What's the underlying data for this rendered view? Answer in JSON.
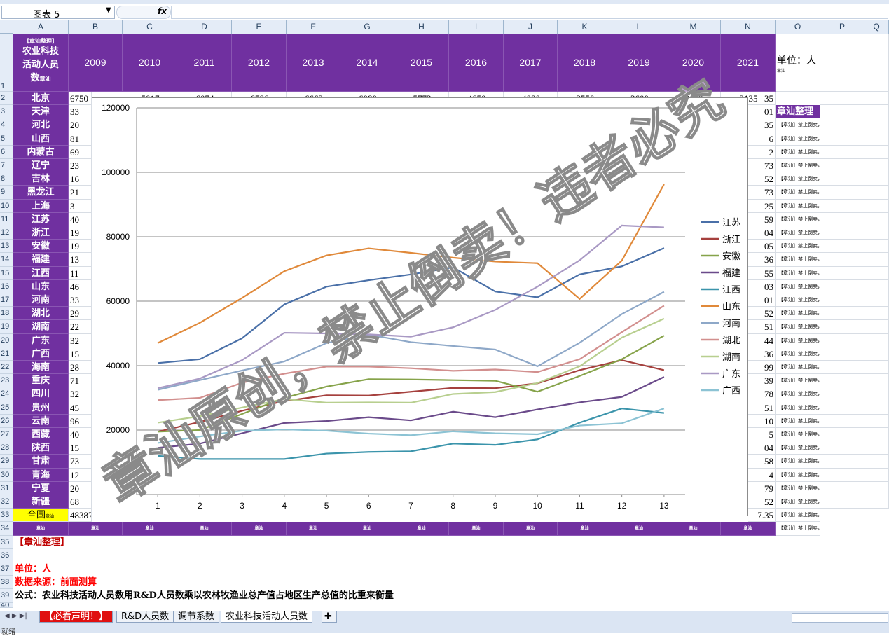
{
  "formula_bar": {
    "name_box": "图表 5",
    "fx": "fx"
  },
  "columns": [
    "A",
    "B",
    "C",
    "D",
    "E",
    "F",
    "G",
    "H",
    "I",
    "J",
    "K",
    "L",
    "M",
    "N",
    "O",
    "P",
    "Q"
  ],
  "rows": [
    "1",
    "2",
    "3",
    "4",
    "5",
    "6",
    "7",
    "8",
    "9",
    "10",
    "11",
    "12",
    "13",
    "14",
    "15",
    "16",
    "17",
    "18",
    "19",
    "20",
    "21",
    "22",
    "23",
    "24",
    "25",
    "26",
    "27",
    "28",
    "29",
    "30",
    "31",
    "32",
    "33",
    "34",
    "35",
    "36",
    "37",
    "38",
    "39",
    "40"
  ],
  "header": {
    "a1_tag": "【章汕整理】",
    "a1_title_line1": "农业科技",
    "a1_title_line2": "活动人员",
    "a1_title_line3": "数",
    "a1_title_mark": "章汕",
    "years": [
      "2009",
      "2010",
      "2011",
      "2012",
      "2013",
      "2014",
      "2015",
      "2016",
      "2017",
      "2018",
      "2019",
      "2020",
      "2021"
    ],
    "unit": "单位：人",
    "unit_mark": "章汕"
  },
  "provinces": [
    "北京",
    "天津",
    "河北",
    "山西",
    "内蒙古",
    "辽宁",
    "吉林",
    "黑龙江",
    "上海",
    "江苏",
    "浙江",
    "安徽",
    "福建",
    "江西",
    "山东",
    "河南",
    "湖北",
    "湖南",
    "广东",
    "广西",
    "海南",
    "重庆",
    "四川",
    "贵州",
    "云南",
    "西藏",
    "陕西",
    "甘肃",
    "青海",
    "宁夏",
    "新疆"
  ],
  "col_b_visible": [
    "6",
    "33",
    "20",
    "81",
    "69",
    "23",
    "16",
    "21",
    "3",
    "40",
    "19",
    "19",
    "13",
    "11",
    "46",
    "33",
    "29",
    "22",
    "32",
    "15",
    "28",
    "71",
    "32",
    "45",
    "96",
    "40",
    "15",
    "73",
    "12",
    "20",
    "68"
  ],
  "col_n_visible": [
    "35",
    "01",
    "35",
    "6",
    "2",
    "73",
    "52",
    "73",
    "25",
    "59",
    "04",
    "05",
    "36",
    "55",
    "03",
    "01",
    "52",
    "51",
    "44",
    "36",
    "99",
    "39",
    "78",
    "51",
    "10",
    "5",
    "04",
    "58",
    "4",
    "79",
    "52"
  ],
  "row2_partial": [
    "6750",
    "5017",
    "6074",
    "6786",
    "6663",
    "6080",
    "5773",
    "4650",
    "4080",
    "3550",
    "3600",
    "3160",
    "3135"
  ],
  "national": {
    "label": "全国",
    "mark": "章汕",
    "b_value": "48387",
    "n_value": "7.35"
  },
  "o_col": {
    "title": "章汕整理",
    "notice": "【章汕】禁止倒卖，违者必究"
  },
  "row34_mark": "章汕",
  "bottom_notes": {
    "a35": "【章汕整理】",
    "a37": "单位：人",
    "a38": "数据来源：前面测算",
    "a39": "公式：农业科技活动人员数用R&D人员数乘以农林牧渔业总产值占地区生产总值的比重来衡量"
  },
  "watermark": "章汕原创，禁止倒卖！违者必究",
  "sheet_tabs": [
    "【必看声明！】",
    "R&D人员数",
    "调节系数",
    "农业科技活动人员数"
  ],
  "status_text": "就绪",
  "chart_data": {
    "type": "line",
    "title": "",
    "xlabel": "",
    "ylabel": "",
    "x": [
      1,
      2,
      3,
      4,
      5,
      6,
      7,
      8,
      9,
      10,
      11,
      12,
      13
    ],
    "ylim": [
      0,
      120000
    ],
    "yticks": [
      0,
      20000,
      40000,
      60000,
      80000,
      100000,
      120000
    ],
    "grid": true,
    "legend_position": "right",
    "series": [
      {
        "name": "江苏",
        "color": "#4a70a8",
        "values": [
          40800,
          42000,
          48500,
          59000,
          64500,
          66500,
          68300,
          70500,
          63000,
          61200,
          68300,
          70800,
          76500
        ]
      },
      {
        "name": "浙江",
        "color": "#a5403d",
        "values": [
          19500,
          22500,
          26000,
          29000,
          30800,
          30700,
          31900,
          33100,
          33000,
          34500,
          38600,
          41700,
          38600
        ]
      },
      {
        "name": "安徽",
        "color": "#86a34a",
        "values": [
          19500,
          20000,
          25000,
          30000,
          33500,
          35800,
          35700,
          35500,
          35300,
          31900,
          36800,
          42000,
          49300
        ]
      },
      {
        "name": "福建",
        "color": "#6a4a8a",
        "values": [
          14500,
          15800,
          19000,
          22200,
          22800,
          24000,
          23000,
          25700,
          24000,
          26400,
          28600,
          30300,
          36500
        ]
      },
      {
        "name": "江西",
        "color": "#3b94ab",
        "values": [
          12000,
          11000,
          11000,
          11000,
          12700,
          13200,
          13400,
          15800,
          15400,
          17100,
          22300,
          26700,
          25300
        ]
      },
      {
        "name": "山东",
        "color": "#e0893a",
        "values": [
          47000,
          53300,
          61000,
          69300,
          74200,
          76400,
          75000,
          73500,
          72300,
          71800,
          60700,
          72600,
          96300
        ]
      },
      {
        "name": "河南",
        "color": "#8ea8c8",
        "values": [
          32500,
          35500,
          38500,
          41300,
          47000,
          49600,
          47300,
          46100,
          45000,
          39800,
          47100,
          56000,
          62900
        ]
      },
      {
        "name": "湖北",
        "color": "#d28f8e",
        "values": [
          29300,
          30000,
          34700,
          37500,
          39700,
          39700,
          39200,
          38400,
          38800,
          38000,
          42000,
          50400,
          58600
        ]
      },
      {
        "name": "湖南",
        "color": "#b8cf8f",
        "values": [
          22300,
          24300,
          27000,
          29600,
          28500,
          28600,
          28500,
          31200,
          31800,
          34600,
          39800,
          48700,
          54600
        ]
      },
      {
        "name": "广东",
        "color": "#a999c4",
        "values": [
          33000,
          36000,
          41700,
          50200,
          50000,
          49700,
          49000,
          51900,
          57300,
          64500,
          72700,
          83500,
          82900
        ]
      },
      {
        "name": "广西",
        "color": "#8cc3d4",
        "values": [
          16000,
          18000,
          19800,
          20200,
          19800,
          18900,
          18400,
          19600,
          19000,
          18700,
          21400,
          22100,
          26700
        ]
      }
    ]
  }
}
